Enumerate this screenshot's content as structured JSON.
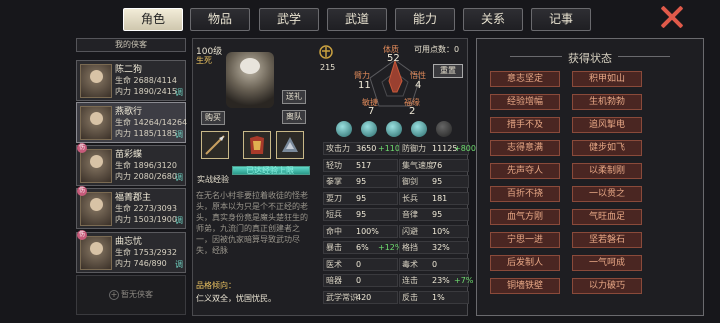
{
  "tabs": [
    {
      "label": "角色",
      "active": true
    },
    {
      "label": "物品",
      "dot": true
    },
    {
      "label": "武学"
    },
    {
      "label": "武道"
    },
    {
      "label": "能力"
    },
    {
      "label": "关系"
    },
    {
      "label": "记事"
    }
  ],
  "roster": {
    "header": "我的侠客",
    "members": [
      {
        "name": "陈二狗",
        "hp": "生命 2688/4114",
        "mp": "内力 1890/2415",
        "tag": "调",
        "selected": false,
        "badge": ""
      },
      {
        "name": "燕歌行",
        "hp": "生命 14264/14264",
        "mp": "内力 1185/1185",
        "tag": "调",
        "selected": true,
        "badge": ""
      },
      {
        "name": "苗彩蝶",
        "hp": "生命 1896/3120",
        "mp": "内力 2080/2680",
        "tag": "调",
        "selected": false,
        "badge": "伤"
      },
      {
        "name": "福菁郡主",
        "hp": "生命 2273/3093",
        "mp": "内力 1503/1900",
        "tag": "调",
        "selected": false,
        "badge": "伤"
      },
      {
        "name": "曲忘忧",
        "hp": "生命 1753/2932",
        "mp": "内力 746/890",
        "tag": "调",
        "selected": false,
        "badge": "伤"
      }
    ],
    "empty_slot": "暂无侠客"
  },
  "character": {
    "level": "100级",
    "state": "生死",
    "coins": "215",
    "free_points": "可用点数：0",
    "buttons": {
      "gift": "送礼",
      "leave": "离队",
      "buy": "购买",
      "reset": "重置"
    },
    "radar": {
      "tizhi": {
        "label": "体质",
        "value": "52"
      },
      "biili": {
        "label": "臂力",
        "value": "11"
      },
      "wuxing": {
        "label": "悟性",
        "value": "4"
      },
      "minjie": {
        "label": "敏捷",
        "value": "7"
      },
      "fuyuan": {
        "label": "福缘",
        "value": "2"
      }
    },
    "xp_label": "实战经验",
    "xp_status": "已达经验上限",
    "xp_fraction": 1.0,
    "description": "在无名小村非要拉着收徒的怪老头，原本以为只是个不正经的老头，真实身份竟是魔头楚狂生的师弟，九流门的真正创建者之一，因被仇家暗算导致武功尽失，经脉",
    "trait_label": "品格倾向：",
    "trait_value": "仁义双全，忧国忧民。"
  },
  "stats": [
    {
      "k": "攻击力",
      "v": "3650",
      "b": "+1100",
      "k2": "防御力",
      "v2": "11125",
      "b2": "+800"
    },
    {
      "k": "轻功",
      "v": "517",
      "b": "",
      "k2": "集气速度",
      "v2": "76",
      "b2": ""
    },
    {
      "k": "拳掌",
      "v": "95",
      "b": "",
      "k2": "御剑",
      "v2": "95",
      "b2": ""
    },
    {
      "k": "耍刀",
      "v": "95",
      "b": "",
      "k2": "长兵",
      "v2": "181",
      "b2": ""
    },
    {
      "k": "短兵",
      "v": "95",
      "b": "",
      "k2": "音律",
      "v2": "95",
      "b2": ""
    },
    {
      "k": "命中",
      "v": "100%",
      "b": "",
      "k2": "闪避",
      "v2": "10%",
      "b2": ""
    },
    {
      "k": "暴击",
      "v": "6%",
      "b": "+12%",
      "k2": "格挡",
      "v2": "32%",
      "b2": ""
    },
    {
      "k": "医术",
      "v": "0",
      "b": "",
      "k2": "毒术",
      "v2": "0",
      "b2": ""
    },
    {
      "k": "暗器",
      "v": "0",
      "b": "",
      "k2": "连击",
      "v2": "23%",
      "b2": "+7%"
    },
    {
      "k": "武学常识",
      "v": "420",
      "b": "",
      "k2": "反击",
      "v2": "1%",
      "b2": ""
    }
  ],
  "status_panel": {
    "title": "获得状态",
    "items": [
      "意志坚定",
      "积甲如山",
      "经验增幅",
      "生机勃勃",
      "措手不及",
      "追风掣电",
      "志得意满",
      "健步如飞",
      "先声夺人",
      "以柔制刚",
      "百折不挠",
      "一以贯之",
      "血气方刚",
      "气旺血足",
      "宁思一进",
      "坚若磐石",
      "后发制人",
      "一气呵成",
      "铜墙铁壁",
      "以力破巧"
    ]
  },
  "colors": {
    "accent_teal": "#5fd8c8",
    "status_red": "#4a2622",
    "gold": "#e8c060",
    "bonus_green": "#6fdc6f"
  }
}
